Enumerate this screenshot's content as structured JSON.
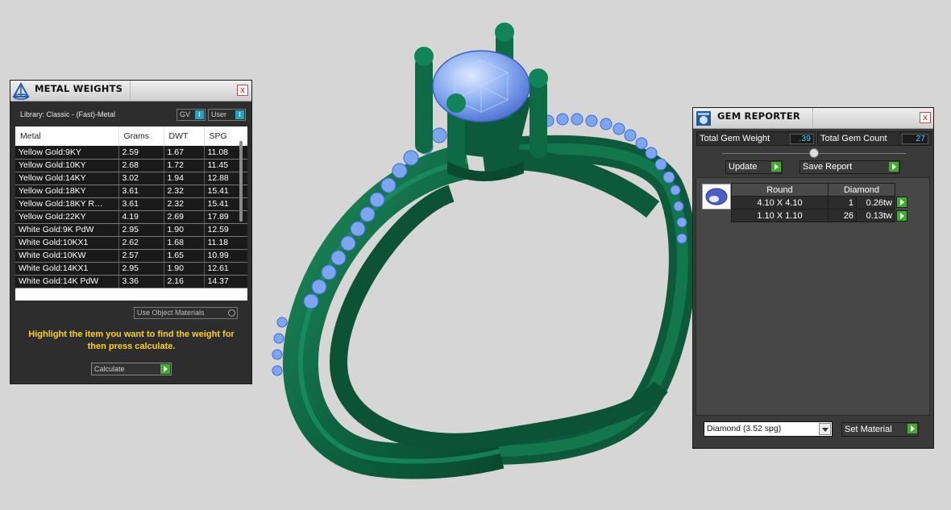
{
  "colors": {
    "ring": "#0f6a45",
    "gem": "#7aa2ee",
    "panel": "#2d2d2d",
    "hint": "#ffd21a",
    "value": "#3fd0ff",
    "go": "#3fae2a"
  },
  "metal_panel": {
    "title": "METAL WEIGHTS",
    "title_icon": "metal-weights-icon",
    "close": "x",
    "library_label": "Library: Classic - (Fast)-Metal",
    "gv_label": "GV",
    "gv_btn": "I",
    "user_label": "User",
    "user_btn": "I",
    "columns": [
      "Metal",
      "Grams",
      "DWT",
      "SPG"
    ],
    "rows": [
      [
        "Yellow Gold:9KY",
        "2.59",
        "1.67",
        "11.08"
      ],
      [
        "Yellow Gold:10KY",
        "2.68",
        "1.72",
        "11.45"
      ],
      [
        "Yellow Gold:14KY",
        "3.02",
        "1.94",
        "12.88"
      ],
      [
        "Yellow Gold:18KY",
        "3.61",
        "2.32",
        "15.41"
      ],
      [
        "Yellow Gold:18KY R…",
        "3.61",
        "2.32",
        "15.41"
      ],
      [
        "Yellow Gold:22KY",
        "4.19",
        "2.69",
        "17.89"
      ],
      [
        "White Gold:9K PdW",
        "2.95",
        "1.90",
        "12.59"
      ],
      [
        "White Gold:10KX1",
        "2.62",
        "1.68",
        "11.18"
      ],
      [
        "White Gold:10KW",
        "2.57",
        "1.65",
        "10.99"
      ],
      [
        "White Gold:14KX1",
        "2.95",
        "1.90",
        "12.61"
      ],
      [
        "White Gold:14K PdW",
        "3.36",
        "2.16",
        "14.37"
      ]
    ],
    "use_object_materials": "Use Object Materials",
    "hint": "Highlight the item you want to find the weight for then press calculate.",
    "calculate": "Calculate"
  },
  "gem_panel": {
    "title": "GEM REPORTER",
    "title_icon": "gem-reporter-icon",
    "close": "x",
    "total_weight_label": "Total Gem Weight",
    "total_weight": ".39",
    "total_count_label": "Total Gem Count",
    "total_count": "27",
    "update": "Update",
    "save_report": "Save Report",
    "table_headers": [
      "Round",
      "Diamond"
    ],
    "gems": [
      {
        "size": "4.10 X 4.10",
        "count": "1",
        "weight": "0.26tw"
      },
      {
        "size": "1.10 X 1.10",
        "count": "26",
        "weight": "0.13tw"
      }
    ],
    "material": "Diamond    (3.52 spg)",
    "set_material": "Set Material"
  }
}
